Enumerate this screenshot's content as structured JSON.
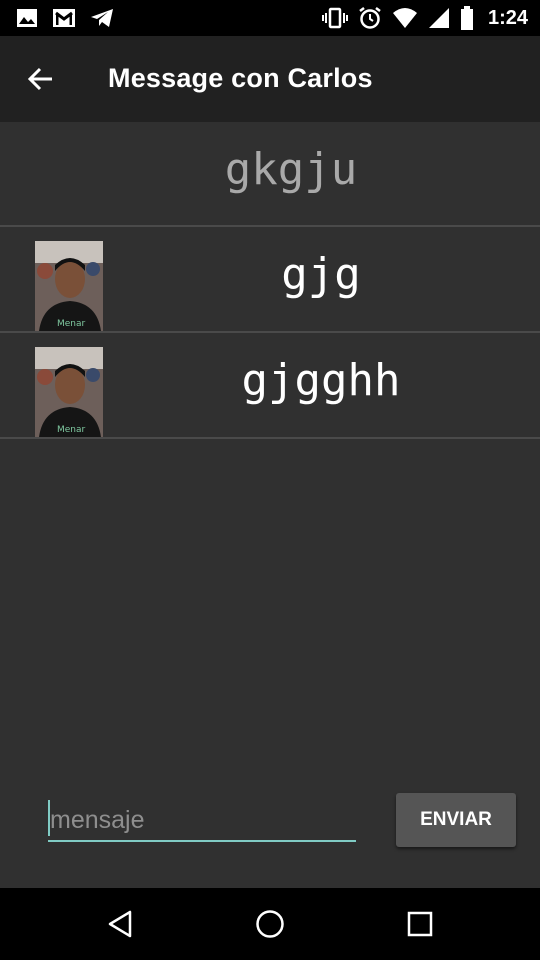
{
  "status_bar": {
    "time": "1:24",
    "left_icons": [
      "image-icon",
      "gmail-icon",
      "telegram-icon"
    ],
    "right_icons": [
      "vibrate-icon",
      "alarm-icon",
      "wifi-icon",
      "signal-icon",
      "battery-icon"
    ]
  },
  "app_bar": {
    "title": "Message con Carlos",
    "back_icon": "back-arrow-icon"
  },
  "messages": [
    {
      "text": "gkgju",
      "has_avatar": false
    },
    {
      "text": "gjg",
      "has_avatar": true
    },
    {
      "text": "gjgghh",
      "has_avatar": true
    }
  ],
  "compose": {
    "placeholder": "mensaje",
    "value": "",
    "send_label": "ENVIAR"
  },
  "colors": {
    "background": "#303030",
    "app_bar": "#212121",
    "accent": "#80cbc4",
    "button": "#555555"
  },
  "nav_bar": {
    "icons": [
      "back-triangle-icon",
      "home-circle-icon",
      "recents-square-icon"
    ]
  }
}
